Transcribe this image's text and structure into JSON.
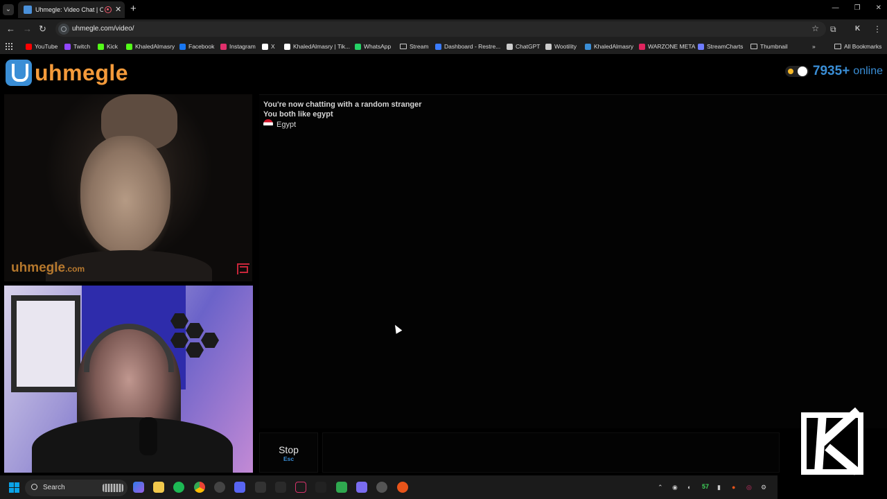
{
  "browser": {
    "tab_title": "Uhmegle: Video Chat | Ome",
    "url": "uhmegle.com/video/",
    "bookmarks": [
      {
        "label": "YouTube",
        "icon": "youtube-icon",
        "color": "#ff0000"
      },
      {
        "label": "Twitch",
        "icon": "twitch-icon",
        "color": "#9146ff"
      },
      {
        "label": "Kick",
        "icon": "kick-icon",
        "color": "#53fc18"
      },
      {
        "label": "KhaledAlmasry",
        "icon": "kick-icon",
        "color": "#53fc18"
      },
      {
        "label": "Facebook",
        "icon": "facebook-icon",
        "color": "#1877f2"
      },
      {
        "label": "Instagram",
        "icon": "instagram-icon",
        "color": "#e1306c"
      },
      {
        "label": "X",
        "icon": "x-icon",
        "color": "#ffffff"
      },
      {
        "label": "KhaledAlmasry | Tik...",
        "icon": "tiktok-icon",
        "color": "#ffffff"
      },
      {
        "label": "WhatsApp",
        "icon": "whatsapp-icon",
        "color": "#25d366"
      },
      {
        "label": "Stream",
        "icon": "folder-icon",
        "color": "#cccccc"
      },
      {
        "label": "Dashboard - Restre...",
        "icon": "restream-icon",
        "color": "#3a7bfd"
      },
      {
        "label": "ChatGPT",
        "icon": "chatgpt-icon",
        "color": "#cccccc"
      },
      {
        "label": "Wootility",
        "icon": "wootility-icon",
        "color": "#cccccc"
      },
      {
        "label": "KhaledAlmasry",
        "icon": "meta-icon",
        "color": "#3a8ed6"
      },
      {
        "label": "WARZONE META",
        "icon": "warzone-icon",
        "color": "#e0245e"
      },
      {
        "label": "StreamCharts",
        "icon": "streamcharts-icon",
        "color": "#6f7cff"
      },
      {
        "label": "Thumbnail",
        "icon": "folder-icon",
        "color": "#cccccc"
      }
    ],
    "all_bookmarks": "All Bookmarks"
  },
  "site": {
    "logo_text": "uhmegle",
    "online_count": "7935+",
    "online_label": "online"
  },
  "stranger_video": {
    "watermark": "uhmegle",
    "watermark_suffix": ".com"
  },
  "chat": {
    "status_line": "You're now chatting with a random stranger",
    "interest_line": "You both like egypt",
    "country": "Egypt"
  },
  "controls": {
    "stop_label": "Stop",
    "stop_key": "Esc"
  },
  "taskbar": {
    "search_label": "Search",
    "tray_number": "57"
  }
}
